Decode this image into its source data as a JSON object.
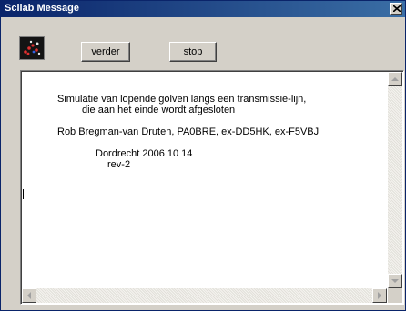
{
  "window": {
    "title": "Scilab Message",
    "close_glyph": "×"
  },
  "toolbar": {
    "app_icon": "scilab-icon",
    "next_label": "verder",
    "stop_label": "stop"
  },
  "message": {
    "lines": [
      "Simulatie van lopende golven langs een transmissie-lijn,",
      "die aan het einde wordt afgesloten",
      "Rob Bregman-van Druten, PA0BRE, ex-DD5HK, ex-F5VBJ",
      "Dordrecht 2006 10 14",
      "rev-2"
    ]
  },
  "scrollbars": {
    "up_icon": "arrow-up-icon",
    "down_icon": "arrow-down-icon",
    "left_icon": "arrow-left-icon",
    "right_icon": "arrow-right-icon"
  },
  "colors": {
    "titlebar": "#0a246a",
    "face": "#d4d0c8",
    "text_bg": "#ffffff"
  }
}
